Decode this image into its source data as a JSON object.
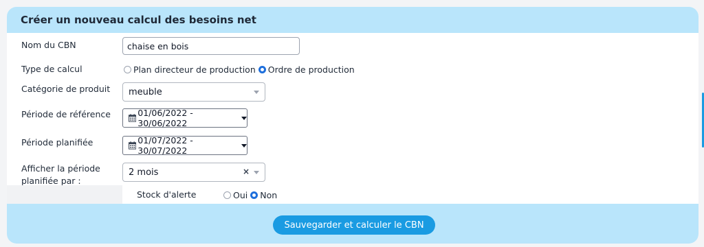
{
  "header": {
    "title": "Créer un nouveau calcul des besoins net"
  },
  "form": {
    "name": {
      "label": "Nom du CBN",
      "value": "chaise en bois"
    },
    "calc_type": {
      "label": "Type de calcul",
      "options": [
        {
          "label": "Plan directeur de production",
          "checked": false
        },
        {
          "label": "Ordre de production",
          "checked": true
        }
      ]
    },
    "category": {
      "label": "Catégorie de produit",
      "value": "meuble"
    },
    "reference_period": {
      "label": "Période de référence",
      "value": "01/06/2022 - 30/06/2022"
    },
    "planned_period": {
      "label": "Période planifiée",
      "value": "01/07/2022 - 30/07/2022"
    },
    "display_by": {
      "label_line1": "Afficher la période",
      "label_line2": "planifiée par :",
      "value": "2 mois",
      "clear": "×"
    },
    "alert_stock": {
      "label": "Stock d'alerte",
      "options": [
        {
          "label": "Oui",
          "checked": false
        },
        {
          "label": "Non",
          "checked": true
        }
      ]
    }
  },
  "footer": {
    "save_label": "Sauvegarder et calculer le CBN"
  },
  "colors": {
    "header_bg": "#b9e5fb",
    "accent": "#1a9be2",
    "radio_checked": "#1e6fdc"
  }
}
